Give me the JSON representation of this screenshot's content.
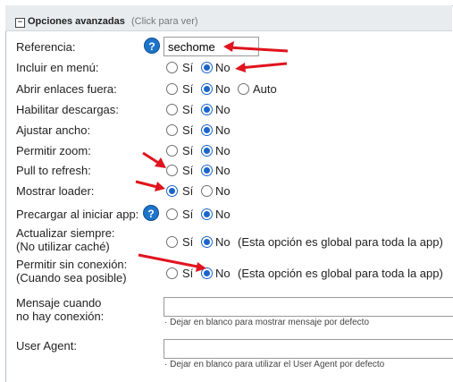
{
  "section": {
    "toggle_symbol": "−",
    "title": "Opciones avanzadas",
    "hint": "(Click para ver)"
  },
  "fields": {
    "referencia": {
      "label": "Referencia:",
      "value": "sechome",
      "help": "?"
    },
    "incluir_menu": {
      "label": "Incluir en menú:",
      "options": [
        "Sí",
        "No"
      ],
      "selected": "No"
    },
    "abrir_enlaces": {
      "label": "Abrir enlaces fuera:",
      "options": [
        "Sí",
        "No",
        "Auto"
      ],
      "selected": "No"
    },
    "habilitar_descargas": {
      "label": "Habilitar descargas:",
      "options": [
        "Sí",
        "No"
      ],
      "selected": "No"
    },
    "ajustar_ancho": {
      "label": "Ajustar ancho:",
      "options": [
        "Sí",
        "No"
      ],
      "selected": "No"
    },
    "permitir_zoom": {
      "label": "Permitir zoom:",
      "options": [
        "Sí",
        "No"
      ],
      "selected": "No"
    },
    "pull_refresh": {
      "label": "Pull to refresh:",
      "options": [
        "Sí",
        "No"
      ],
      "selected": "No"
    },
    "mostrar_loader": {
      "label": "Mostrar loader:",
      "options": [
        "Sí",
        "No"
      ],
      "selected": "Sí"
    },
    "precargar": {
      "label": "Precargar al iniciar app:",
      "options": [
        "Sí",
        "No"
      ],
      "selected": "No",
      "help": "?"
    },
    "actualizar_siempre": {
      "label_line1": "Actualizar siempre:",
      "label_line2": "(No utilizar caché)",
      "options": [
        "Sí",
        "No"
      ],
      "selected": "No",
      "note": "(Esta opción es global para toda la app)"
    },
    "permitir_sin_conexion": {
      "label_line1": "Permitir sin conexión:",
      "label_line2": "(Cuando sea posible)",
      "options": [
        "Sí",
        "No"
      ],
      "selected": "No",
      "note": "(Esta opción es global para toda la app)"
    },
    "mensaje_sin_conexion": {
      "label_line1": "Mensaje cuando",
      "label_line2": "no hay conexión:",
      "value": "",
      "hint": "· Dejar en blanco para mostrar mensaje por defecto"
    },
    "user_agent": {
      "label": "User Agent:",
      "value": "",
      "hint": "· Dejar en blanco para utilizar el User Agent por defecto"
    }
  },
  "colors": {
    "accent": "#1a66c9",
    "arrow": "#e0141e",
    "header_bg": "#e9ecef"
  }
}
